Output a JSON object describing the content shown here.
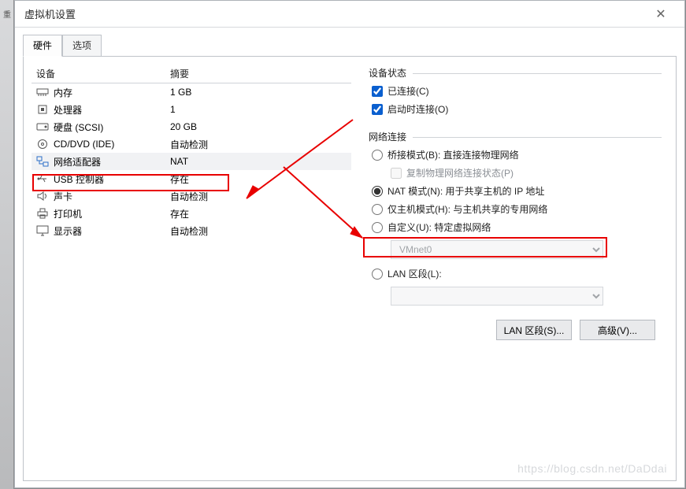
{
  "window": {
    "title": "虚拟机设置",
    "close_glyph": "✕"
  },
  "tabs": {
    "hardware": "硬件",
    "options": "选项"
  },
  "hw": {
    "col_device": "设备",
    "col_summary": "摘要",
    "rows": [
      {
        "dev": "内存",
        "sum": "1 GB"
      },
      {
        "dev": "处理器",
        "sum": "1"
      },
      {
        "dev": "硬盘 (SCSI)",
        "sum": "20 GB"
      },
      {
        "dev": "CD/DVD (IDE)",
        "sum": "自动检测"
      },
      {
        "dev": "网络适配器",
        "sum": "NAT"
      },
      {
        "dev": "USB 控制器",
        "sum": "存在"
      },
      {
        "dev": "声卡",
        "sum": "自动检测"
      },
      {
        "dev": "打印机",
        "sum": "存在"
      },
      {
        "dev": "显示器",
        "sum": "自动检测"
      }
    ]
  },
  "status": {
    "title": "设备状态",
    "connected": "已连接(C)",
    "connect_at_poweron": "启动时连接(O)"
  },
  "net": {
    "title": "网络连接",
    "bridged": "桥接模式(B): 直接连接物理网络",
    "replicate": "复制物理网络连接状态(P)",
    "nat": "NAT 模式(N): 用于共享主机的 IP 地址",
    "hostonly": "仅主机模式(H): 与主机共享的专用网络",
    "custom": "自定义(U): 特定虚拟网络",
    "custom_value": "VMnet0",
    "lan": "LAN 区段(L):",
    "lan_value": ""
  },
  "buttons": {
    "lan_segments": "LAN 区段(S)...",
    "advanced": "高级(V)..."
  },
  "watermark": "https://blog.csdn.net/DaDdai",
  "colors": {
    "highlight": "#e80000"
  }
}
